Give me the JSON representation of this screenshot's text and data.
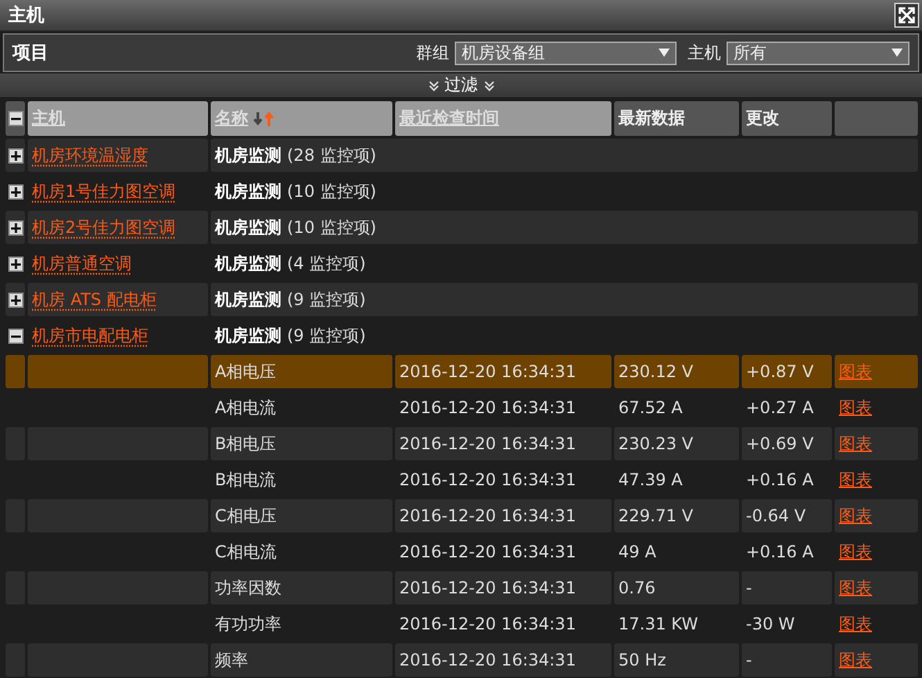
{
  "window": {
    "title": "主机"
  },
  "toolbar": {
    "label": "项目",
    "filters": [
      {
        "label": "群组",
        "value": "机房设备组"
      },
      {
        "label": "主机",
        "value": "所有"
      }
    ]
  },
  "filter_bar": {
    "label": "过滤",
    "expanded": false
  },
  "table": {
    "all_expanded": true,
    "columns": [
      {
        "label": "主机",
        "sortable": true
      },
      {
        "label": "名称",
        "sortable": true,
        "sorted_ascending": true
      },
      {
        "label": "最近检查时间",
        "sortable": true
      },
      {
        "label": "最新数据",
        "sortable": false
      },
      {
        "label": "更改",
        "sortable": false
      }
    ],
    "groups": [
      {
        "host": "机房环境温湿度",
        "summary": "**机房监测** (28 监控项)",
        "expanded": false
      },
      {
        "host": "机房1号佳力图空调",
        "summary": "**机房监测** (10 监控项)",
        "expanded": false
      },
      {
        "host": "机房2号佳力图空调",
        "summary": "**机房监测** (10 监控项)",
        "expanded": false
      },
      {
        "host": "机房普通空调",
        "summary": "**机房监测** (4 监控项)",
        "expanded": false
      },
      {
        "host": "机房 ATS 配电柜",
        "summary": "**机房监测** (9 监控项)",
        "expanded": false
      },
      {
        "host": "机房市电配电柜",
        "summary": "**机房监测** (9 监控项)",
        "expanded": true,
        "items": [
          {
            "name": "A相电压",
            "time": "2016-12-20 16:34:31",
            "value": "230.12 V",
            "change": "+0.87 V",
            "link": "图表",
            "selected": true
          },
          {
            "name": "A相电流",
            "time": "2016-12-20 16:34:31",
            "value": "67.52 A",
            "change": "+0.27 A",
            "link": "图表",
            "selected": false
          },
          {
            "name": "B相电压",
            "time": "2016-12-20 16:34:31",
            "value": "230.23 V",
            "change": "+0.69 V",
            "link": "图表",
            "selected": false
          },
          {
            "name": "B相电流",
            "time": "2016-12-20 16:34:31",
            "value": "47.39 A",
            "change": "+0.16 A",
            "link": "图表",
            "selected": false
          },
          {
            "name": "C相电压",
            "time": "2016-12-20 16:34:31",
            "value": "229.71 V",
            "change": "-0.64 V",
            "link": "图表",
            "selected": false
          },
          {
            "name": "C相电流",
            "time": "2016-12-20 16:34:31",
            "value": "49 A",
            "change": "+0.16 A",
            "link": "图表",
            "selected": false
          },
          {
            "name": "功率因数",
            "time": "2016-12-20 16:34:31",
            "value": "0.76",
            "change": "-",
            "link": "图表",
            "selected": false
          },
          {
            "name": "有功功率",
            "time": "2016-12-20 16:34:31",
            "value": "17.31 KW",
            "change": "-30 W",
            "link": "图表",
            "selected": false
          },
          {
            "name": "频率",
            "time": "2016-12-20 16:34:31",
            "value": "50 Hz",
            "change": "-",
            "link": "图表",
            "selected": false
          }
        ]
      }
    ]
  }
}
